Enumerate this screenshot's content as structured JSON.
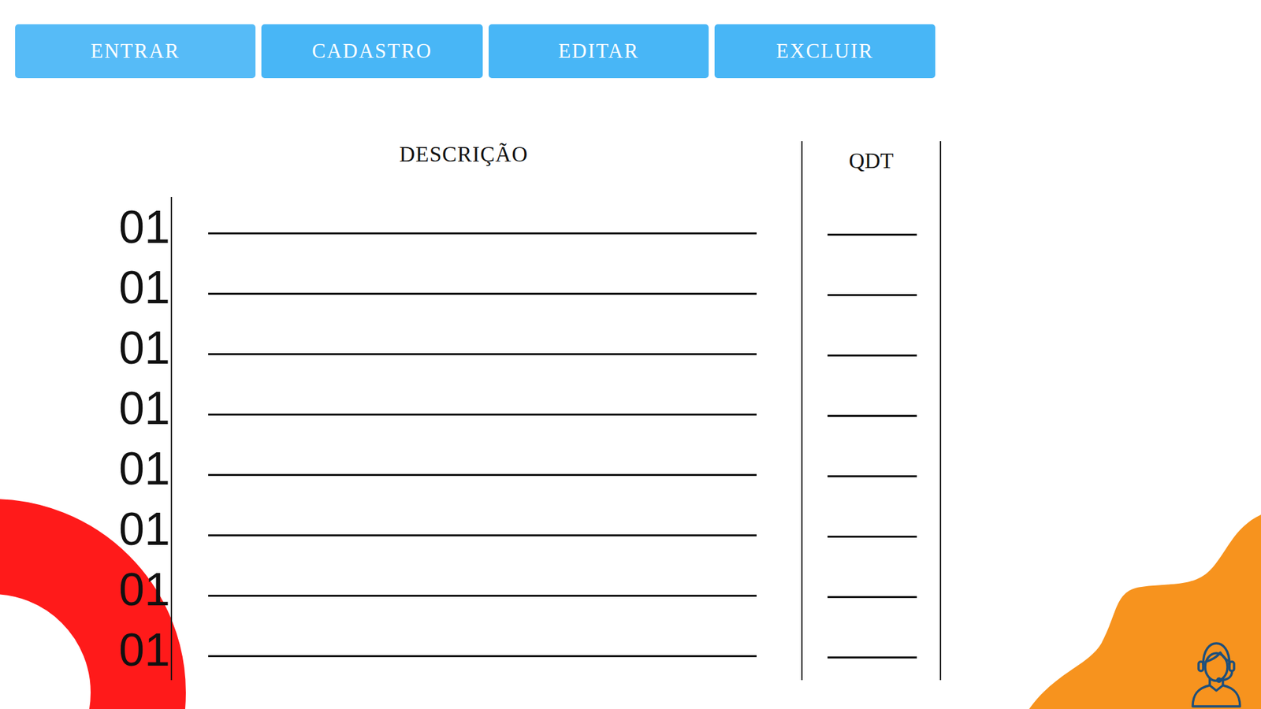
{
  "buttons": [
    {
      "label": "ENTRAR"
    },
    {
      "label": "CADASTRO"
    },
    {
      "label": "EDITAR"
    },
    {
      "label": "EXCLUIR"
    }
  ],
  "table": {
    "columns": {
      "description": "DESCRIÇÃO",
      "quantity": "QDT"
    },
    "rows": [
      {
        "number": "01"
      },
      {
        "number": "01"
      },
      {
        "number": "01"
      },
      {
        "number": "01"
      },
      {
        "number": "01"
      },
      {
        "number": "01"
      },
      {
        "number": "01"
      },
      {
        "number": "01"
      }
    ]
  }
}
